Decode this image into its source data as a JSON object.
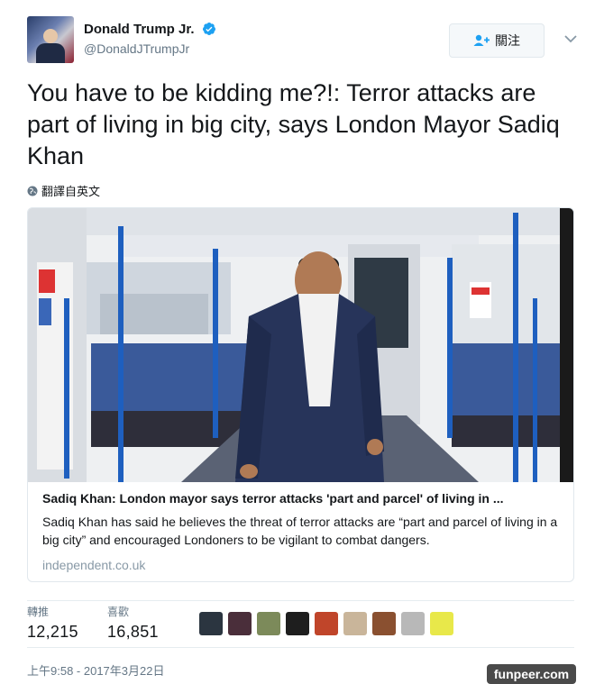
{
  "author": {
    "display_name": "Donald Trump Jr.",
    "handle": "@DonaldJTrumpJr",
    "verified": true
  },
  "follow_button": {
    "icon": "add-user-icon",
    "label": "關注"
  },
  "tweet": {
    "text": "You have to be kidding me?!: Terror attacks are part of living in big city, says London Mayor Sadiq Khan",
    "translate_label": "翻譯自英文"
  },
  "card": {
    "title": "Sadiq Khan: London mayor says terror attacks 'part and parcel' of living in ...",
    "description": "Sadiq Khan has said he believes the threat of terror attacks are “part and parcel of living in a big city” and encouraged Londoners to be vigilant to combat dangers.",
    "domain": "independent.co.uk"
  },
  "stats": {
    "retweets_label": "轉推",
    "retweets_value": "12,215",
    "likes_label": "喜歡",
    "likes_value": "16,851"
  },
  "timestamp": "上午9:58 - 2017年3月22日",
  "watermark": "funpeer.com",
  "colors": {
    "verified_blue": "#1da1f2",
    "train_pole_blue": "#1e5fbf",
    "seat_blue": "#3a5a9a"
  }
}
